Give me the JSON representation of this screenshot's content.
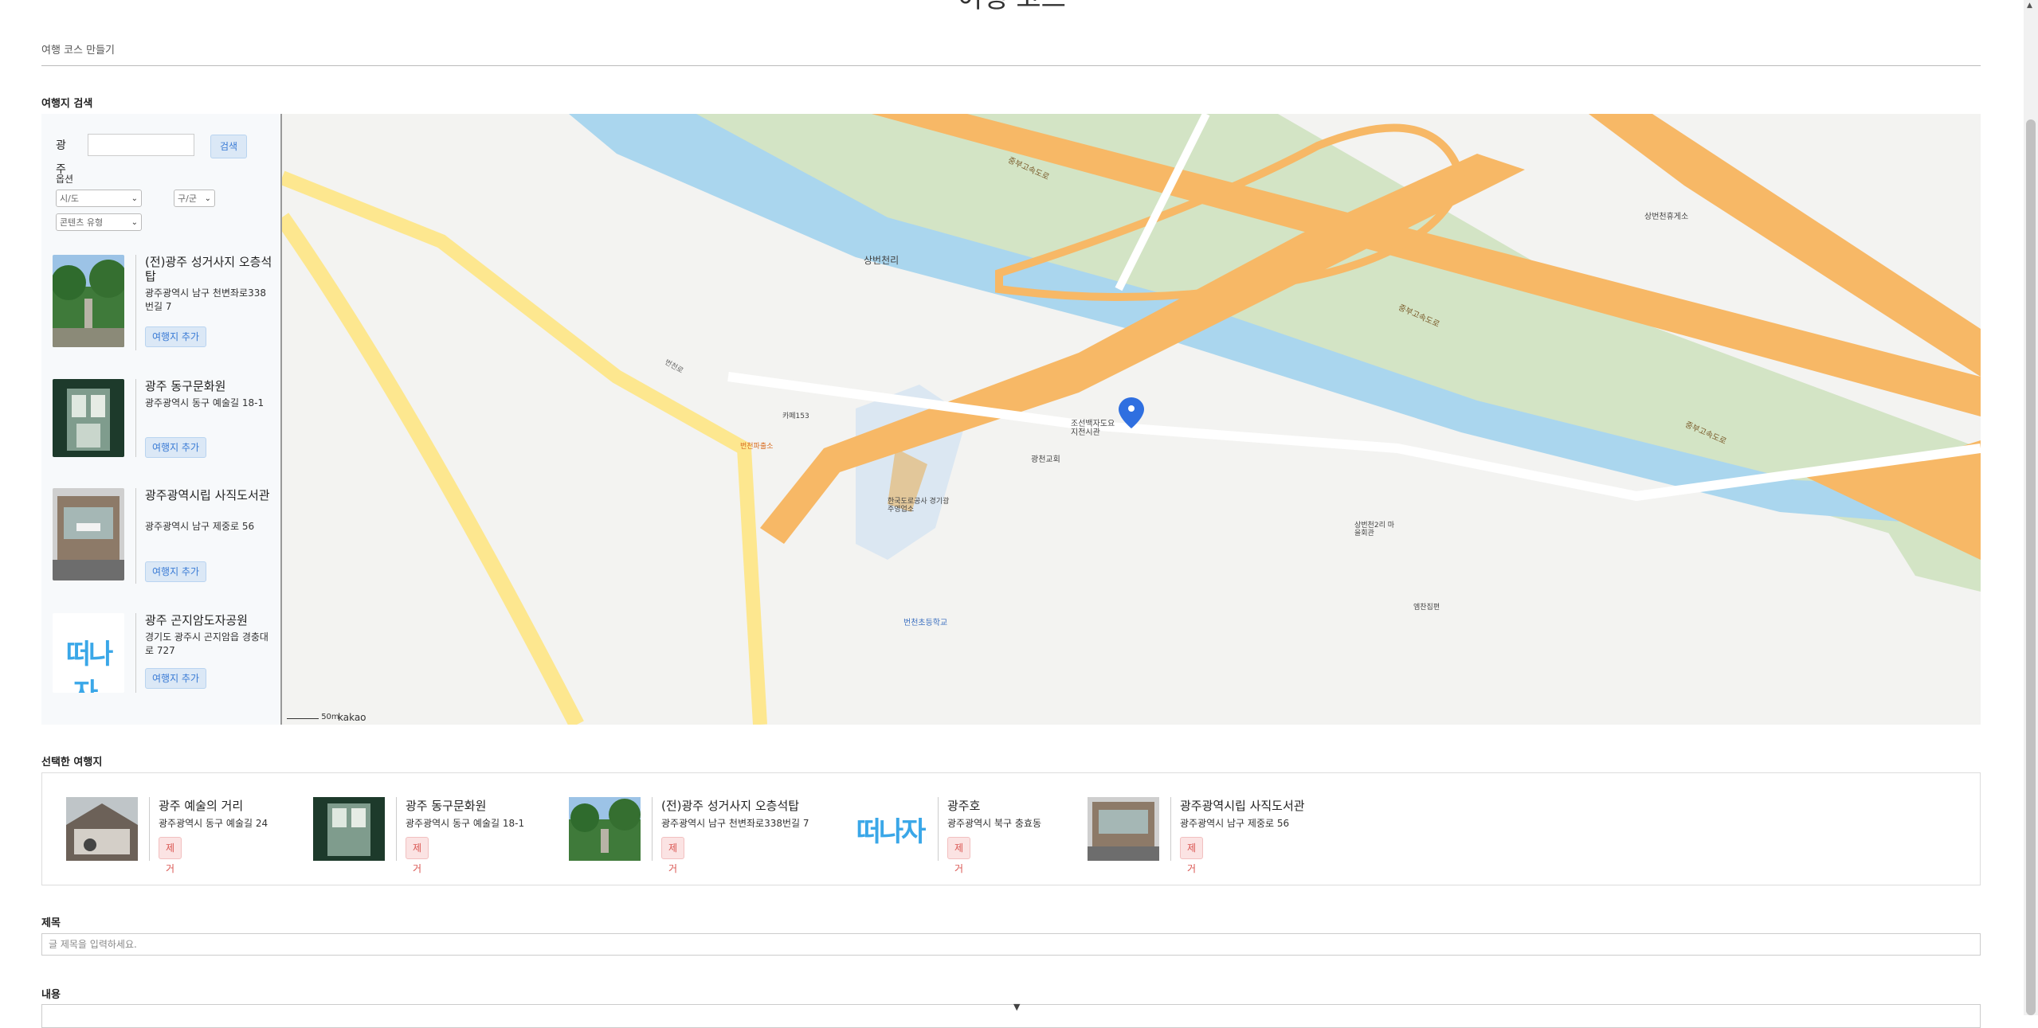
{
  "page": {
    "title": "여행 코스",
    "breadcrumb": "여행 코스 만들기"
  },
  "search": {
    "section_label": "여행지 검색",
    "keyword_label": "광주",
    "button_label": "검색",
    "options_label": "옵션",
    "select_province": "시/도",
    "select_district": "구/군",
    "select_content_type": "콘텐츠 유형",
    "add_label": "여행지 추가",
    "results": [
      {
        "title": "(전)광주 성거사지 오층석탑",
        "address": "광주광역시 남구 천변좌로338번길 7",
        "thumb": "pagoda-photo"
      },
      {
        "title": "광주 동구문화원",
        "address": "광주광역시 동구 예술길 18-1",
        "thumb": "culture-center-photo"
      },
      {
        "title": "광주광역시립 사직도서관",
        "address": "광주광역시 남구 제중로 56",
        "thumb": "library-photo"
      },
      {
        "title": "광주 곤지암도자공원",
        "address": "경기도 광주시 곤지암읍 경충대로 727",
        "thumb": "tteonaja-logo"
      }
    ]
  },
  "map": {
    "scale_label": "50m",
    "logo_label": "kakao",
    "labels": {
      "village1": "상번천리",
      "school": "번천초등학교",
      "church": "광천교회",
      "hall": "조선백자도요지전시관",
      "highway1": "중부고속도로",
      "highway2": "중부고속도로",
      "highway3": "중부고속도로",
      "rest1": "상번천휴게소",
      "police": "번천파출소",
      "cafe": "카페153",
      "korail": "한국도로공사 경기광주영업소",
      "village2": "상번천2리 마을회관",
      "road1": "번천로",
      "place1": "엠찬집편"
    }
  },
  "selected": {
    "section_label": "선택한 여행지",
    "remove_label": "제거",
    "items": [
      {
        "title": "광주 예술의 거리",
        "address": "광주광역시 동구 예술길 24",
        "thumb": "art-street-photo"
      },
      {
        "title": "광주 동구문화원",
        "address": "광주광역시 동구 예술길 18-1",
        "thumb": "culture-center-photo"
      },
      {
        "title": "(전)광주 성거사지 오층석탑",
        "address": "광주광역시 남구 천변좌로338번길 7",
        "thumb": "pagoda-photo"
      },
      {
        "title": "광주호",
        "address": "광주광역시 북구 충효동",
        "thumb": "tteonaja-logo"
      },
      {
        "title": "광주광역시립 사직도서관",
        "address": "광주광역시 남구 제중로 56",
        "thumb": "library-photo"
      }
    ]
  },
  "form": {
    "title_label": "제목",
    "title_placeholder": "글 제목을 입력하세요.",
    "content_label": "내용",
    "logo_text": "떠나자."
  },
  "colors": {
    "accent_blue": "#3a7bd5",
    "remove_red": "#d9534f",
    "highway": "#f6b766",
    "river": "#a8d8ef"
  }
}
